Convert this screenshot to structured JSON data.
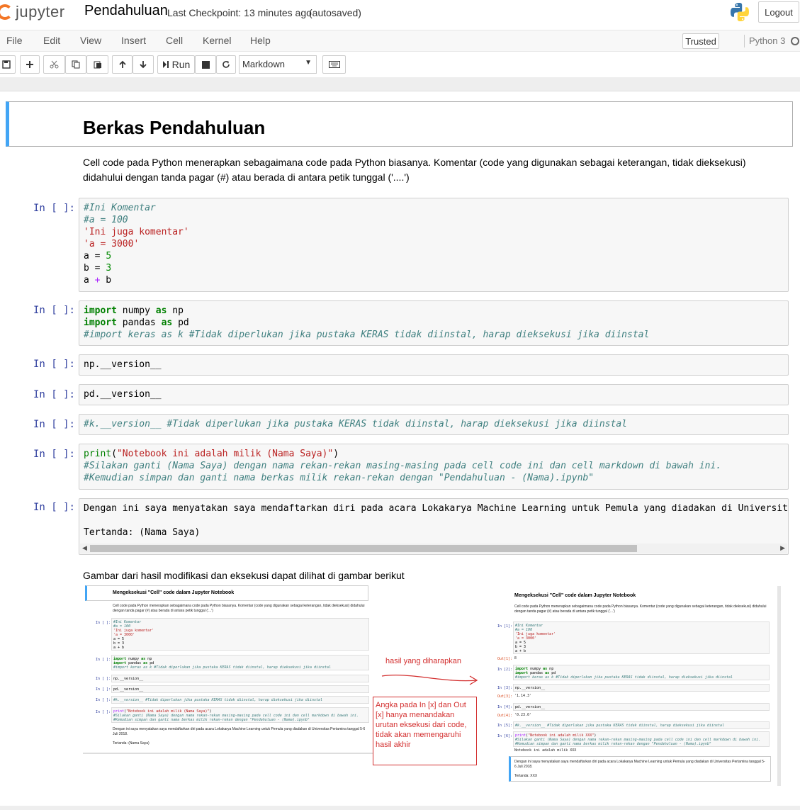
{
  "header": {
    "logo_text": "jupyter",
    "notebook_name": "Pendahuluan",
    "checkpoint": "Last Checkpoint: 13 minutes ago",
    "autosave": "(autosaved)",
    "logout_label": "Logout"
  },
  "menu": {
    "items": [
      "File",
      "Edit",
      "View",
      "Insert",
      "Cell",
      "Kernel",
      "Help"
    ],
    "trusted_label": "Trusted",
    "kernel_name": "Python 3"
  },
  "toolbar": {
    "run_label": "Run",
    "cell_type": "Markdown",
    "icons": [
      "save-icon",
      "plus-icon",
      "cut-icon",
      "copy-icon",
      "paste-icon",
      "arrow-up-icon",
      "arrow-down-icon",
      "run-icon",
      "stop-icon",
      "restart-icon",
      "keyboard-icon"
    ]
  },
  "notebook": {
    "title": "Berkas Pendahuluan",
    "intro": "Cell code pada Python menerapkan sebagaimana code pada Python biasanya. Komentar (code yang digunakan sebagai keterangan, tidak dieksekusi) didahului dengan tanda pagar (#) atau berada di antara petik tunggal ('....')",
    "prompt": "In [ ]:",
    "cells": [
      {
        "lines": [
          "#Ini Komentar",
          "#a = 100",
          "'Ini juga komentar'",
          "'a = 3000'",
          "a = 5",
          "b = 3",
          "a + b"
        ]
      },
      {
        "lines": [
          "import numpy as np",
          "import pandas as pd",
          "#import keras as k #Tidak diperlukan jika pustaka KERAS tidak diinstal, harap dieksekusi jika diinstal"
        ]
      },
      {
        "lines": [
          "np.__version__"
        ]
      },
      {
        "lines": [
          "pd.__version__"
        ]
      },
      {
        "lines": [
          "#k.__version__ #Tidak diperlukan jika pustaka KERAS tidak diinstal, harap dieksekusi jika diinstal"
        ]
      },
      {
        "lines": [
          "print(\"Notebook ini adalah milik (Nama Saya)\")",
          "#Silakan ganti (Nama Saya) dengan nama rekan-rekan masing-masing pada cell code ini dan cell markdown di bawah ini.",
          "#Kemudian simpan dan ganti nama berkas milik rekan-rekan dengan \"Pendahuluan - (Nama).ipynb\""
        ]
      },
      {
        "lines": [
          "Dengan ini saya menyatakan saya mendaftarkan diri pada acara Lokakarya Machine Learning untuk Pemula yang diadakan di Universitas",
          "",
          "Tertanda: (Nama Saya)"
        ]
      }
    ],
    "image_caption": "Gambar dari hasil modifikasi dan eksekusi dapat dilihat di gambar berikut"
  },
  "embedded_image": {
    "left_title": "Mengeksekusi \"Cell\" code dalam Jupyter Notebook",
    "right_title": "Mengeksekusi \"Cell\" code dalam Jupyter Notebook",
    "arrow_label": "hasil yang diharapkan",
    "note": "Angka pada In [x] dan Out [x] hanya menandakan urutan eksekusi dari code, tidak akan memengaruhi hasil akhir",
    "left_para": "Cell code pada Python menerapkan sebagaimana code pada Python biasanya. Komentar (code yang digunakan sebagai keterangan, tidak dieksekusi) didahului dengan tanda pagar (#) atau berada di antara petik tunggal ('...')",
    "left_footer_1": "Dengan ini saya menyatakan saya mendaftarkan diri pada acara Lokakarya Machine Learning untuk Pemula yang diadakan di Universitas Pertamina tanggal 5-6 Juli 2018.",
    "left_footer_2": "Tertanda: (Nama Saya)",
    "right_footer_1": "Dengan ini saya menyatakan saya mendaftarkan diri pada acara Lokakarya Machine Learning untuk Pemula yang diadakan di Universitas Pertamina tanggal 5-6 Juli 2018.",
    "right_footer_2": "Tertanda: XXX",
    "out_8": "8",
    "out_np": "'1.14.3'",
    "out_pd": "'0.23.0'",
    "out_print": "Notebook ini adalah milik XXX"
  }
}
